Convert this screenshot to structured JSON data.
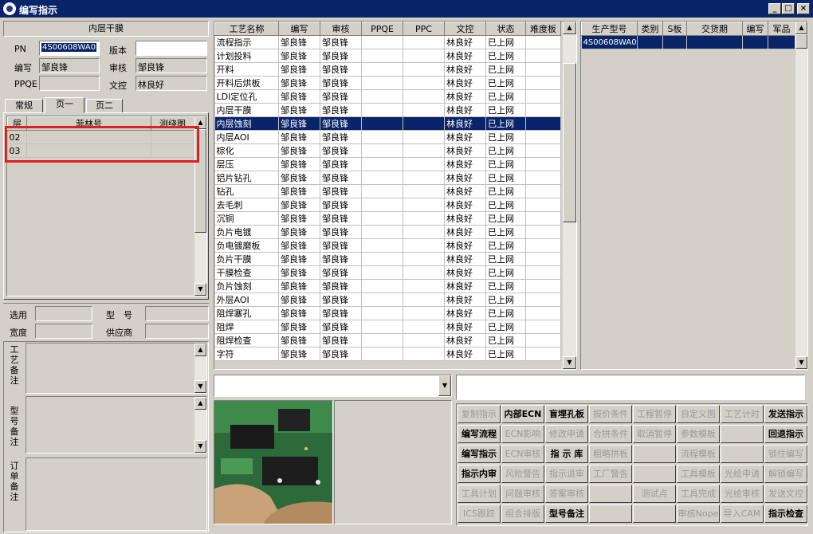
{
  "window": {
    "title": "编写指示",
    "minimize": "_",
    "maximize": "□",
    "close": "×"
  },
  "left": {
    "header": "内层干膜",
    "pn_label": "PN",
    "pn_value": "4S00608WA0",
    "version_label": "版本",
    "version_value": "",
    "writer_label": "编写",
    "writer_value": "邹良锋",
    "reviewer_label": "审核",
    "reviewer_value": "邹良锋",
    "ppqe_label": "PPQE",
    "ppqe_value": "",
    "doc_label": "文控",
    "doc_value": "林良好",
    "tabs": [
      "常规",
      "页一",
      "页二"
    ],
    "layer_table": {
      "columns": [
        "层",
        "菲林号",
        "测绕图"
      ],
      "rows": [
        [
          "02",
          "",
          ""
        ],
        [
          "03",
          "",
          ""
        ]
      ]
    },
    "select_label": "选用",
    "select_value": "",
    "model_label": "型　号",
    "model_value": "",
    "width_label": "宽度",
    "width_value": "",
    "supplier_label": "供应商",
    "supplier_value": "",
    "process_note_label": "工艺备注",
    "model_note_label": "型号备注",
    "order_note_label": "订单备注",
    "highlight_color": "#e02020"
  },
  "process_table": {
    "columns": [
      "工艺名称",
      "编写",
      "审核",
      "PPQE",
      "PPC",
      "文控",
      "状态",
      "难度板"
    ],
    "selected_index": 6,
    "rows": [
      [
        "流程指示",
        "邹良锋",
        "邹良锋",
        "",
        "",
        "林良好",
        "已上网",
        ""
      ],
      [
        "计划投料",
        "邹良锋",
        "邹良锋",
        "",
        "",
        "林良好",
        "已上网",
        ""
      ],
      [
        "开料",
        "邹良锋",
        "邹良锋",
        "",
        "",
        "林良好",
        "已上网",
        ""
      ],
      [
        "开料后烘板",
        "邹良锋",
        "邹良锋",
        "",
        "",
        "林良好",
        "已上网",
        ""
      ],
      [
        "LDI定位孔",
        "邹良锋",
        "邹良锋",
        "",
        "",
        "林良好",
        "已上网",
        ""
      ],
      [
        "内层干膜",
        "邹良锋",
        "邹良锋",
        "",
        "",
        "林良好",
        "已上网",
        ""
      ],
      [
        "内层蚀刻",
        "邹良锋",
        "邹良锋",
        "",
        "",
        "林良好",
        "已上网",
        ""
      ],
      [
        "内层AOI",
        "邹良锋",
        "邹良锋",
        "",
        "",
        "林良好",
        "已上网",
        ""
      ],
      [
        "棕化",
        "邹良锋",
        "邹良锋",
        "",
        "",
        "林良好",
        "已上网",
        ""
      ],
      [
        "层压",
        "邹良锋",
        "邹良锋",
        "",
        "",
        "林良好",
        "已上网",
        ""
      ],
      [
        "铝片钻孔",
        "邹良锋",
        "邹良锋",
        "",
        "",
        "林良好",
        "已上网",
        ""
      ],
      [
        "钻孔",
        "邹良锋",
        "邹良锋",
        "",
        "",
        "林良好",
        "已上网",
        ""
      ],
      [
        "去毛刺",
        "邹良锋",
        "邹良锋",
        "",
        "",
        "林良好",
        "已上网",
        ""
      ],
      [
        "沉铜",
        "邹良锋",
        "邹良锋",
        "",
        "",
        "林良好",
        "已上网",
        ""
      ],
      [
        "负片电镀",
        "邹良锋",
        "邹良锋",
        "",
        "",
        "林良好",
        "已上网",
        ""
      ],
      [
        "负电镀磨板",
        "邹良锋",
        "邹良锋",
        "",
        "",
        "林良好",
        "已上网",
        ""
      ],
      [
        "负片干膜",
        "邹良锋",
        "邹良锋",
        "",
        "",
        "林良好",
        "已上网",
        ""
      ],
      [
        "干膜检查",
        "邹良锋",
        "邹良锋",
        "",
        "",
        "林良好",
        "已上网",
        ""
      ],
      [
        "负片蚀刻",
        "邹良锋",
        "邹良锋",
        "",
        "",
        "林良好",
        "已上网",
        ""
      ],
      [
        "外层AOI",
        "邹良锋",
        "邹良锋",
        "",
        "",
        "林良好",
        "已上网",
        ""
      ],
      [
        "阻焊塞孔",
        "邹良锋",
        "邹良锋",
        "",
        "",
        "林良好",
        "已上网",
        ""
      ],
      [
        "阻焊",
        "邹良锋",
        "邹良锋",
        "",
        "",
        "林良好",
        "已上网",
        ""
      ],
      [
        "阻焊检查",
        "邹良锋",
        "邹良锋",
        "",
        "",
        "林良好",
        "已上网",
        ""
      ],
      [
        "字符",
        "邹良锋",
        "邹良锋",
        "",
        "",
        "林良好",
        "已上网",
        ""
      ]
    ]
  },
  "product_table": {
    "columns": [
      "生产型号",
      "类别",
      "S板",
      "交货期",
      "编写",
      "军品"
    ],
    "rows": [
      [
        "4S00608WA0",
        "",
        "",
        "",
        "",
        ""
      ]
    ]
  },
  "buttons": [
    [
      {
        "t": "复制指示",
        "on": false
      },
      {
        "t": "内部ECN",
        "on": true
      },
      {
        "t": "盲埋孔板",
        "on": true
      },
      {
        "t": "报价条件",
        "on": false
      },
      {
        "t": "工程暂停",
        "on": false
      },
      {
        "t": "自定义图",
        "on": false
      },
      {
        "t": "工艺计时",
        "on": false
      },
      {
        "t": "发送指示",
        "on": true
      }
    ],
    [
      {
        "t": "编写流程",
        "on": true
      },
      {
        "t": "ECN影响",
        "on": false
      },
      {
        "t": "修改申请",
        "on": false
      },
      {
        "t": "合拼条件",
        "on": false
      },
      {
        "t": "取消暂停",
        "on": false
      },
      {
        "t": "参数模板",
        "on": false
      },
      {
        "t": "",
        "on": false
      },
      {
        "t": "回退指示",
        "on": true
      }
    ],
    [
      {
        "t": "编写指示",
        "on": true
      },
      {
        "t": "ECN审核",
        "on": false
      },
      {
        "t": "指 示 库",
        "on": true
      },
      {
        "t": "粗略拼板",
        "on": false
      },
      {
        "t": "",
        "on": false
      },
      {
        "t": "流程模板",
        "on": false
      },
      {
        "t": "",
        "on": false
      },
      {
        "t": "锁住编写",
        "on": false
      }
    ],
    [
      {
        "t": "指示内审",
        "on": true
      },
      {
        "t": "风险警告",
        "on": false
      },
      {
        "t": "指示退审",
        "on": false
      },
      {
        "t": "工厂警告",
        "on": false
      },
      {
        "t": "",
        "on": false
      },
      {
        "t": "工具模板",
        "on": false
      },
      {
        "t": "光绘申请",
        "on": false
      },
      {
        "t": "解锁编写",
        "on": false
      }
    ],
    [
      {
        "t": "工具计划",
        "on": false
      },
      {
        "t": "问题审核",
        "on": false
      },
      {
        "t": "答案审核",
        "on": false
      },
      {
        "t": "",
        "on": false
      },
      {
        "t": "测试点",
        "on": false
      },
      {
        "t": "工具完成",
        "on": false
      },
      {
        "t": "光绘审核",
        "on": false
      },
      {
        "t": "发送文控",
        "on": false
      }
    ],
    [
      {
        "t": "ICS跟踪",
        "on": false
      },
      {
        "t": "组合排版",
        "on": false
      },
      {
        "t": "型号备注",
        "on": true
      },
      {
        "t": "",
        "on": false
      },
      {
        "t": "",
        "on": false
      },
      {
        "t": "审核Nope",
        "on": false
      },
      {
        "t": "导入CAM",
        "on": false
      },
      {
        "t": "指示检查",
        "on": true
      }
    ]
  ]
}
